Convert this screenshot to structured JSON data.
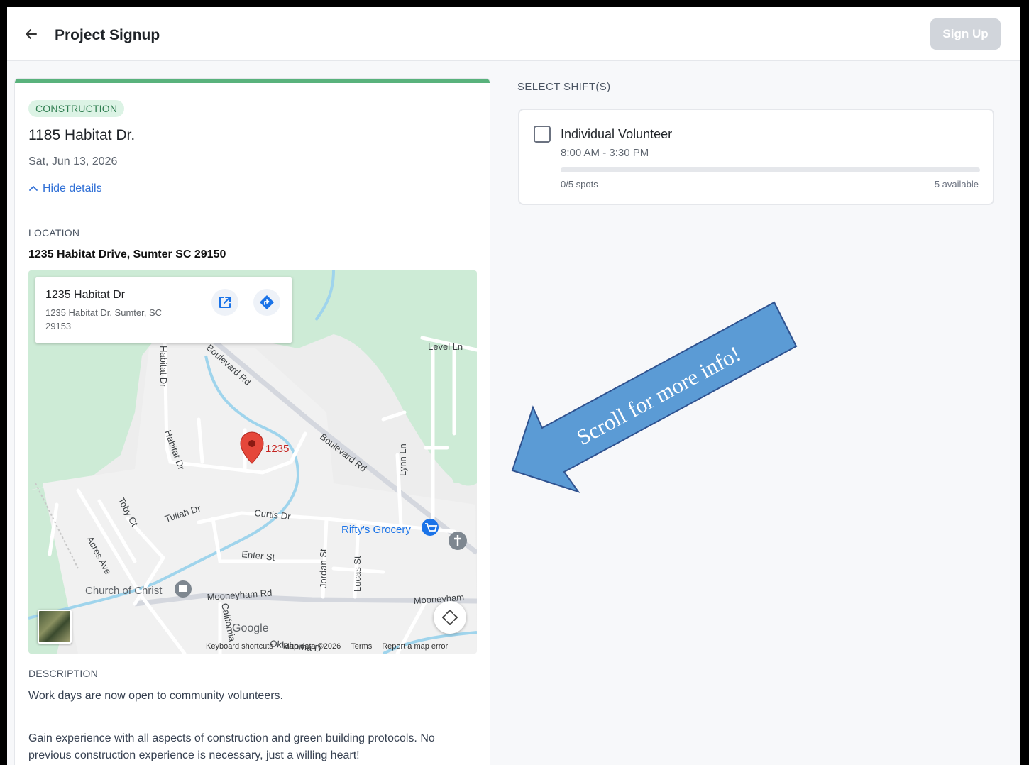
{
  "header": {
    "title": "Project Signup",
    "signup_label": "Sign Up"
  },
  "project": {
    "category": "CONSTRUCTION",
    "name": "1185 Habitat Dr.",
    "date": "Sat, Jun 13, 2026",
    "toggle_label": "Hide details",
    "location_label": "LOCATION",
    "location_address": "1235 Habitat Drive, Sumter SC 29150",
    "description_label": "DESCRIPTION",
    "description_paragraphs": [
      "Work days are now open to community volunteers.",
      "Gain experience with all aspects of construction and green building protocols. No previous construction experience is necessary, just a willing heart!"
    ]
  },
  "map": {
    "popup_title": "1235 Habitat Dr",
    "popup_address": "1235 Habitat Dr, Sumter, SC 29153",
    "marker_label": "1235",
    "streets": {
      "boulevard_1": "Boulevard Rd",
      "boulevard_2": "Boulevard Rd",
      "habitat_1": "Habitat Dr",
      "habitat_2": "Habitat Dr",
      "level": "Level Ln",
      "lynn": "Lynn Ln",
      "tullah": "Tullah Dr",
      "curtis": "Curtis Dr",
      "toby": "Toby Ct",
      "acres": "Acres Ave",
      "enter": "Enter St",
      "jordan": "Jordan St",
      "lucas": "Lucas St",
      "mooneyham_1": "Mooneyham Rd",
      "mooneyham_2": "Mooneyham",
      "california": "California",
      "oklahoma": "Oklahoma D"
    },
    "poi": {
      "grocery": "Rifty's Grocery",
      "church": "Church of Christ"
    },
    "logo": "Google",
    "attribution": [
      "Keyboard shortcuts",
      "Map data ©2026",
      "Terms",
      "Report a map error"
    ],
    "colors": {
      "land": "#ededed",
      "park": "#cdebd6",
      "water": "#9fd4ec",
      "road": "#ffffff",
      "major_road": "#d4d7de",
      "marker": "#e5473a"
    }
  },
  "shifts": {
    "section_label": "SELECT SHIFT(S)",
    "items": [
      {
        "name": "Individual Volunteer",
        "time": "8:00 AM - 3:30 PM",
        "spots_text": "0/5 spots",
        "available_text": "5 available",
        "filled_fraction": 0
      }
    ]
  },
  "annotation": {
    "text": "Scroll for more info!",
    "fill": "#5b9bd5",
    "stroke": "#2f528f"
  },
  "colors": {
    "accent_green": "#59b27c",
    "link_blue": "#2f6fd6",
    "disabled_button": "#d1d5db"
  }
}
